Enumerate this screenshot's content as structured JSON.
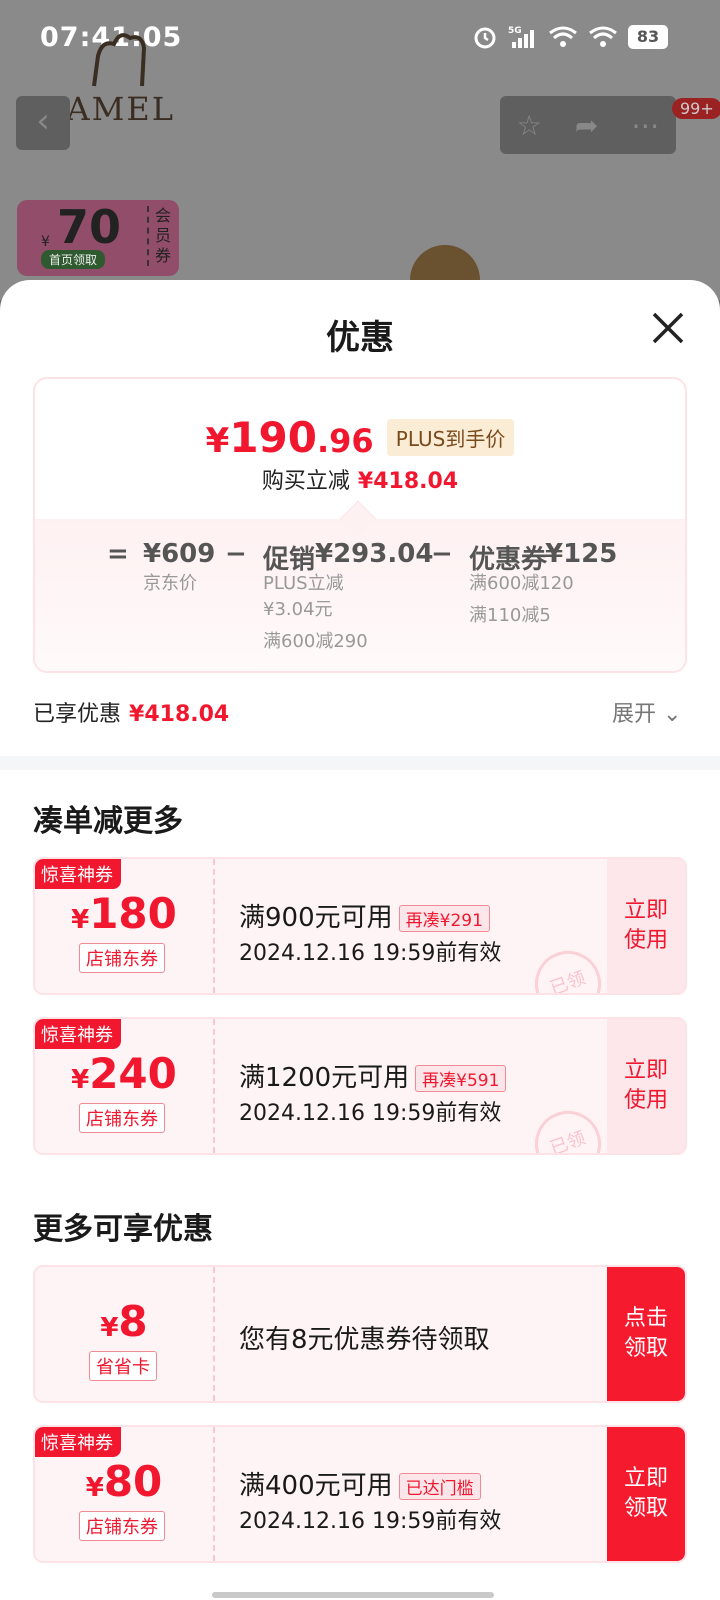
{
  "status": {
    "time": "07:41:05",
    "network": "5G",
    "battery": "83"
  },
  "background": {
    "brand_logo": "CAMEL",
    "cart_badge": "99+",
    "member_coupon": {
      "yen": "¥",
      "amount": "70",
      "tag": "首页领取",
      "side": "会员券"
    }
  },
  "sheet": {
    "title": "优惠",
    "price": {
      "yen": "¥",
      "int": "190",
      "dec": ".96",
      "tag": "PLUS到手价"
    },
    "reduce": {
      "label": "购买立减",
      "amount": "¥418.04"
    },
    "calc": {
      "eq": "=",
      "jd_price": "¥609",
      "jd_label": "京东价",
      "minus": "−",
      "promo_label": "促销",
      "promo_amount": "¥293.04",
      "promo_lines": [
        "PLUS立减",
        "¥3.04元",
        "满600减290"
      ],
      "coupon_label": "优惠券",
      "coupon_amount": "¥125",
      "coupon_lines": [
        "满600减120",
        "满110减5"
      ]
    },
    "enjoyed": {
      "label": "已享优惠",
      "amount": "¥418.04",
      "expand": "展开"
    }
  },
  "section1": {
    "title": "凑单减更多",
    "coupons": [
      {
        "flag": "惊喜神券",
        "yen": "¥",
        "amount": "180",
        "type": "店铺东券",
        "cond": "满900元可用",
        "pill": "再凑¥291",
        "valid": "2024.12.16 19:59前有效",
        "action": "立即使用",
        "stamp": "已领"
      },
      {
        "flag": "惊喜神券",
        "yen": "¥",
        "amount": "240",
        "type": "店铺东券",
        "cond": "满1200元可用",
        "pill": "再凑¥591",
        "valid": "2024.12.16 19:59前有效",
        "action": "立即使用",
        "stamp": "已领"
      }
    ]
  },
  "section2": {
    "title": "更多可享优惠",
    "coupons": [
      {
        "flag": "",
        "yen": "¥",
        "amount": "8",
        "type": "省省卡",
        "cond": "您有8元优惠券待领取",
        "pill": "",
        "valid": "",
        "action": "点击领取"
      },
      {
        "flag": "惊喜神券",
        "yen": "¥",
        "amount": "80",
        "type": "店铺东券",
        "cond": "满400元可用",
        "pill": "已达门槛",
        "valid": "2024.12.16 19:59前有效",
        "action": "立即领取"
      }
    ]
  },
  "colors": {
    "accent_red": "#f0172f",
    "plus_gold": "#fbecd6"
  }
}
